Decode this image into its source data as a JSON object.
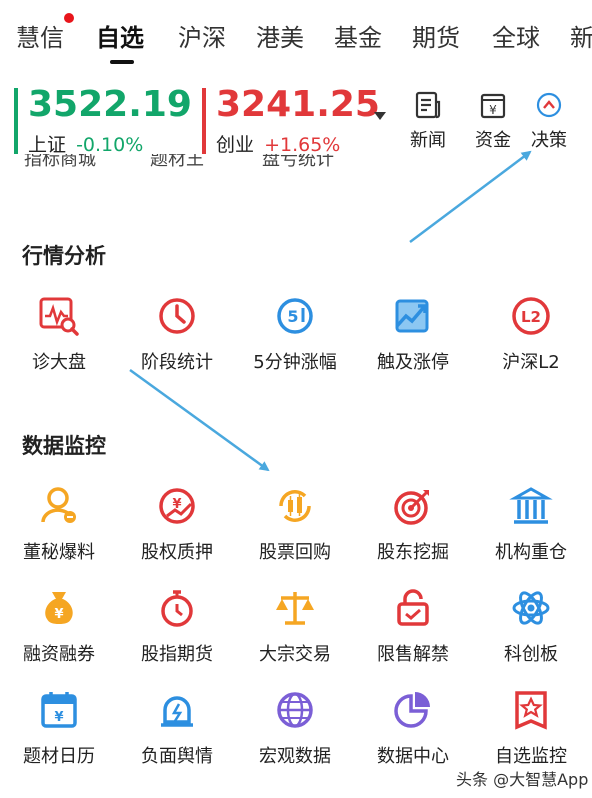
{
  "top_nav": {
    "tabs": [
      {
        "label": "慧信"
      },
      {
        "label": "自选"
      },
      {
        "label": "沪深"
      },
      {
        "label": "港美"
      },
      {
        "label": "基金"
      },
      {
        "label": "期货"
      },
      {
        "label": "全球"
      },
      {
        "label": "新"
      }
    ],
    "active_tab": "自选"
  },
  "indices": [
    {
      "value": "3522.19",
      "name": "上证",
      "change": "-0.10%",
      "color": "#12a66a"
    },
    {
      "value": "3241.25",
      "name": "创业",
      "change": "+1.65%",
      "color": "#e1383a"
    }
  ],
  "quick_actions": [
    {
      "label": "新闻"
    },
    {
      "label": "资金"
    },
    {
      "label": "决策"
    }
  ],
  "partial_row": [
    {
      "label": "指标商城"
    },
    {
      "label": "题材王"
    },
    {
      "label": "盘亏统计"
    }
  ],
  "sections": [
    {
      "title": "行情分析",
      "items": [
        {
          "label": "诊大盘",
          "icon": "diagnose-market-icon"
        },
        {
          "label": "阶段统计",
          "icon": "clock-icon"
        },
        {
          "label": "5分钟涨幅",
          "icon": "five-minute-icon"
        },
        {
          "label": "触及涨停",
          "icon": "trend-up-icon"
        },
        {
          "label": "沪深L2",
          "icon": "l2-icon"
        }
      ]
    },
    {
      "title": "数据监控",
      "items": [
        {
          "label": "董秘爆料",
          "icon": "secretary-icon"
        },
        {
          "label": "股权质押",
          "icon": "equity-pledge-icon"
        },
        {
          "label": "股票回购",
          "icon": "buyback-icon"
        },
        {
          "label": "股东挖掘",
          "icon": "target-icon"
        },
        {
          "label": "机构重仓",
          "icon": "institution-icon"
        },
        {
          "label": "融资融券",
          "icon": "money-bag-icon"
        },
        {
          "label": "股指期货",
          "icon": "stopwatch-icon"
        },
        {
          "label": "大宗交易",
          "icon": "scales-icon"
        },
        {
          "label": "限售解禁",
          "icon": "unlock-icon"
        },
        {
          "label": "科创板",
          "icon": "atom-icon"
        },
        {
          "label": "题材日历",
          "icon": "calendar-icon"
        },
        {
          "label": "负面舆情",
          "icon": "alarm-icon"
        },
        {
          "label": "宏观数据",
          "icon": "globe-icon"
        },
        {
          "label": "数据中心",
          "icon": "pie-chart-icon"
        },
        {
          "label": "自选监控",
          "icon": "star-badge-icon"
        }
      ]
    }
  ],
  "watermark": "头条 @大智慧App",
  "colors": {
    "accent_blue": "#4aa8de",
    "red": "#e1383a",
    "green": "#12a66a",
    "orange": "#f5a623",
    "purple": "#7b5fd6",
    "icon_blue": "#2d8fe0"
  }
}
